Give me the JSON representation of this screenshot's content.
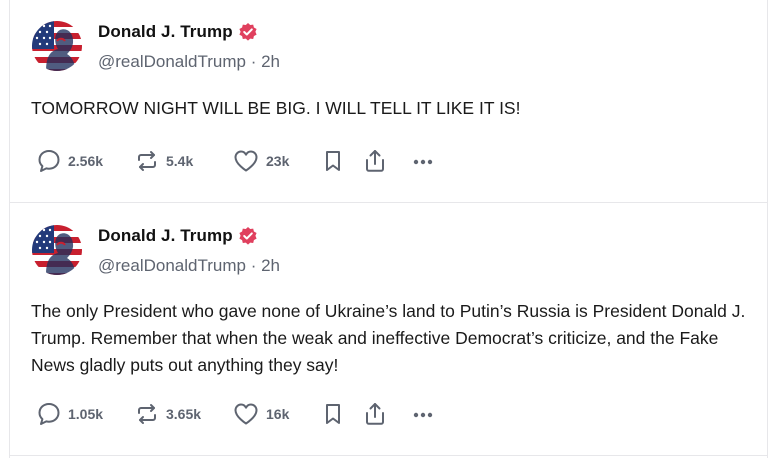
{
  "posts": [
    {
      "author_name": "Donald J. Trump",
      "handle": "@realDonaldTrump",
      "separator": "·",
      "time": "2h",
      "text": "TOMORROW NIGHT WILL BE BIG. I WILL TELL IT LIKE IT IS!",
      "replies": "2.56k",
      "restates": "5.4k",
      "likes": "23k"
    },
    {
      "author_name": "Donald J. Trump",
      "handle": "@realDonaldTrump",
      "separator": "·",
      "time": "2h",
      "text": "The only President who gave none of Ukraine’s land to Putin’s Russia is President Donald J. Trump. Remember that when the weak and ineffective Democrat’s criticize, and the Fake News gladly puts out anything they say!",
      "replies": "1.05k",
      "restates": "3.65k",
      "likes": "16k"
    }
  ],
  "icons": {
    "reply": "speech-bubble-icon",
    "restate": "repost-arrows-icon",
    "like": "heart-icon",
    "bookmark": "bookmark-icon",
    "share": "share-upload-icon",
    "more": "ellipsis-icon",
    "verified": "verified-badge-icon"
  },
  "colors": {
    "verified_badge": "#e0405e",
    "meta_text": "#5e6470",
    "divider": "#e7e7ea"
  }
}
